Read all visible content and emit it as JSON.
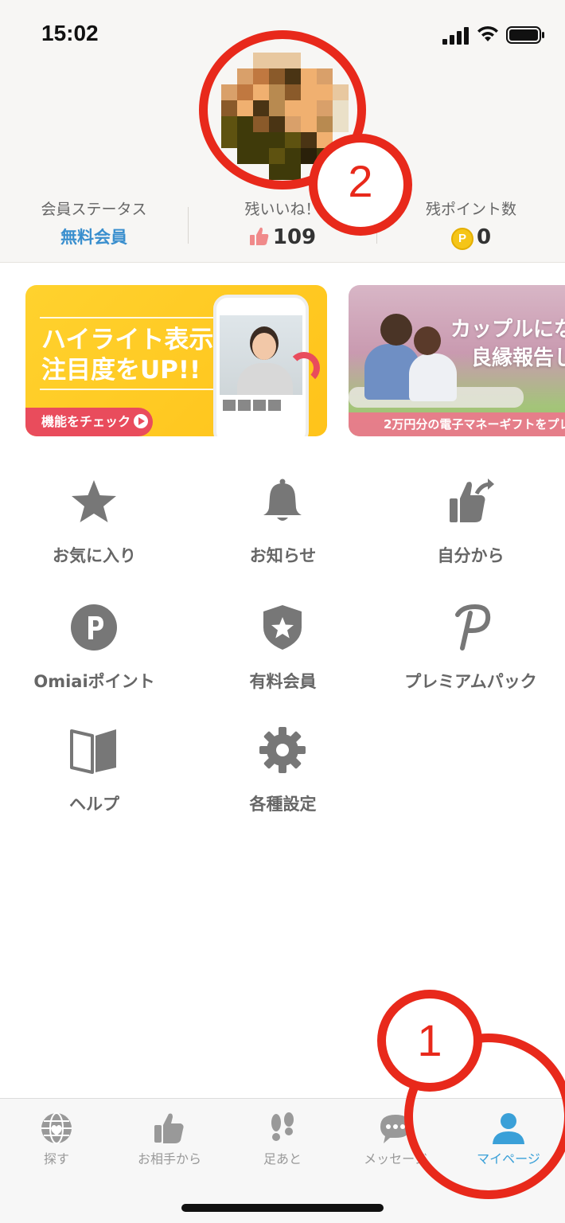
{
  "status_bar": {
    "time": "15:02",
    "signal_icon": "cellular-signal-icon",
    "wifi_icon": "wifi-icon",
    "battery_icon": "battery-icon"
  },
  "profile": {
    "avatar_alt": "pixelated-profile-photo"
  },
  "stats": {
    "member_status": {
      "label": "会員ステータス",
      "value": "無料会員"
    },
    "remaining_likes": {
      "label": "残いいね！",
      "value": "109",
      "icon": "thumbs-up-icon"
    },
    "remaining_points": {
      "label": "残ポイント数",
      "value": "0",
      "icon": "coin-icon",
      "coin_glyph": "P"
    }
  },
  "banners": [
    {
      "title_line1": "ハイライト表示で",
      "title_line2": "注目度をUP!!",
      "cta": "機能をチェック"
    },
    {
      "title_line1": "カップルにな",
      "title_line2": "良縁報告し",
      "ribbon": "2万円分の電子マネーギフトをプレ"
    }
  ],
  "menu": [
    {
      "label": "お気に入り",
      "icon": "star-icon"
    },
    {
      "label": "お知らせ",
      "icon": "bell-icon"
    },
    {
      "label": "自分から",
      "icon": "thumbs-up-share-icon"
    },
    {
      "label": "Omiaiポイント",
      "icon": "points-icon"
    },
    {
      "label": "有料会員",
      "icon": "shield-star-icon"
    },
    {
      "label": "プレミアムパック",
      "icon": "premium-p-icon"
    },
    {
      "label": "ヘルプ",
      "icon": "book-icon"
    },
    {
      "label": "各種設定",
      "icon": "gear-icon"
    }
  ],
  "tabs": [
    {
      "label": "探す",
      "icon": "globe-icon",
      "active": false
    },
    {
      "label": "お相手から",
      "icon": "thumbs-up-icon",
      "active": false
    },
    {
      "label": "足あと",
      "icon": "footprints-icon",
      "active": false
    },
    {
      "label": "メッセージ",
      "icon": "chat-bubble-icon",
      "active": false
    },
    {
      "label": "マイページ",
      "icon": "person-icon",
      "active": true
    }
  ],
  "annotations": {
    "one": "1",
    "two": "2"
  },
  "colors": {
    "accent_blue": "#3aa0d8",
    "member_blue": "#3a8fce",
    "annotation_red": "#e8291b",
    "icon_gray": "#777777",
    "banner_yellow": "#ffc31a",
    "banner_pink": "#e94c5c"
  }
}
